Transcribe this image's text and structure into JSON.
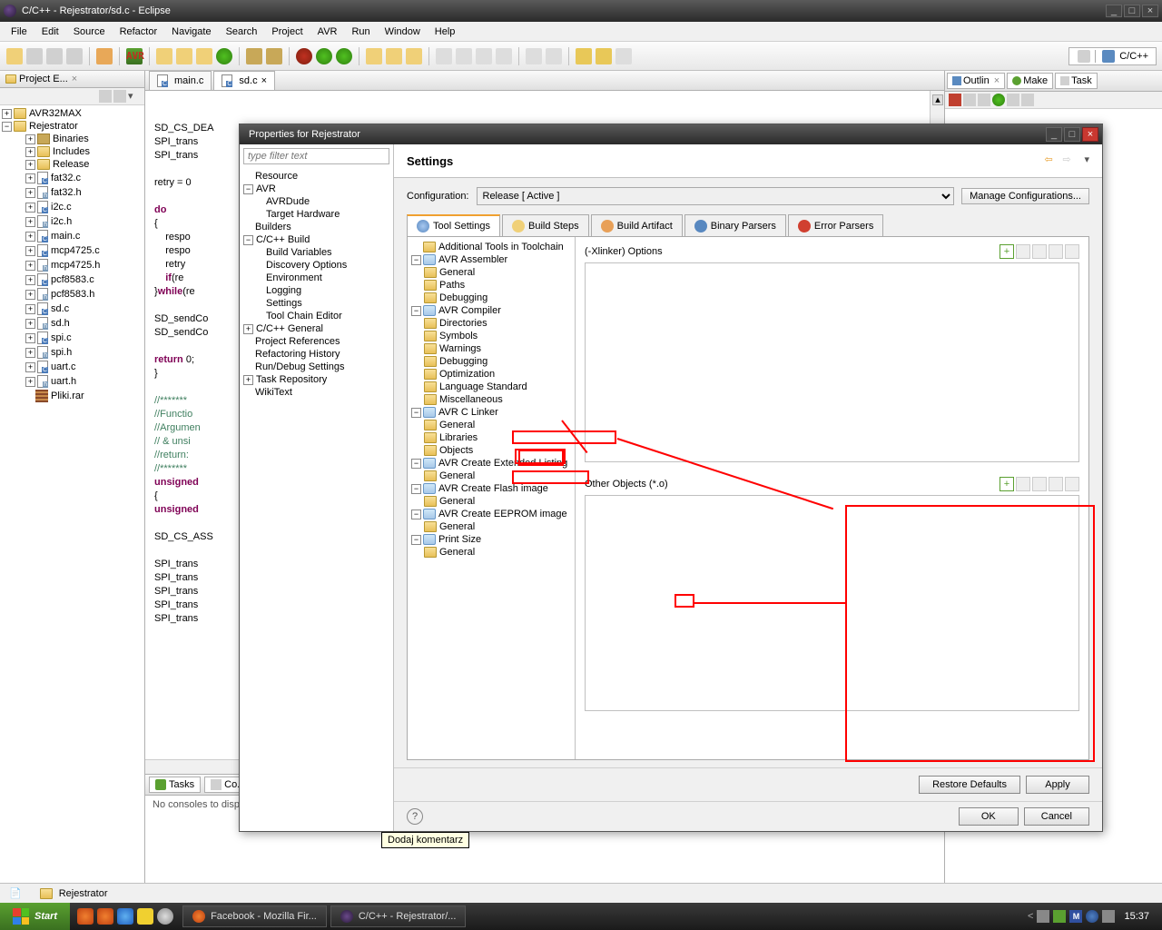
{
  "window": {
    "title": "C/C++ - Rejestrator/sd.c - Eclipse"
  },
  "menu": [
    "File",
    "Edit",
    "Source",
    "Refactor",
    "Navigate",
    "Search",
    "Project",
    "AVR",
    "Run",
    "Window",
    "Help"
  ],
  "perspective_label": "C/C++",
  "views": {
    "project_explorer_label": "Project E..."
  },
  "project_tree": {
    "root1": "AVR32MAX",
    "root2": "Rejestrator",
    "children": [
      {
        "label": "Binaries",
        "type": "bin"
      },
      {
        "label": "Includes",
        "type": "folder"
      },
      {
        "label": "Release",
        "type": "folder"
      },
      {
        "label": "fat32.c",
        "type": "c"
      },
      {
        "label": "fat32.h",
        "type": "h"
      },
      {
        "label": "i2c.c",
        "type": "c"
      },
      {
        "label": "i2c.h",
        "type": "h"
      },
      {
        "label": "main.c",
        "type": "c"
      },
      {
        "label": "mcp4725.c",
        "type": "c"
      },
      {
        "label": "mcp4725.h",
        "type": "h"
      },
      {
        "label": "pcf8583.c",
        "type": "c"
      },
      {
        "label": "pcf8583.h",
        "type": "h"
      },
      {
        "label": "sd.c",
        "type": "c"
      },
      {
        "label": "sd.h",
        "type": "h"
      },
      {
        "label": "spi.c",
        "type": "c"
      },
      {
        "label": "spi.h",
        "type": "h"
      },
      {
        "label": "uart.c",
        "type": "c"
      },
      {
        "label": "uart.h",
        "type": "h"
      },
      {
        "label": "Pliki.rar",
        "type": "rar"
      }
    ]
  },
  "editor_tabs": [
    {
      "label": "main.c"
    },
    {
      "label": "sd.c",
      "active": true
    }
  ],
  "code_lines": [
    "SD_CS_DEA",
    "SPI_trans",
    "SPI_trans",
    "",
    "retry = 0",
    "",
    "do",
    "{",
    "    respo",
    "    respo",
    "    retry",
    "    if(re",
    "}while(re",
    "",
    "SD_sendCo",
    "SD_sendCo",
    "",
    "return 0;",
    "}",
    "",
    "//*******",
    "//Functio",
    "//Argumen",
    "// & unsi",
    "//return:",
    "//*******",
    "unsigned",
    "{",
    "unsigned",
    "",
    "SD_CS_ASS",
    "",
    "SPI_trans",
    "SPI_trans",
    "SPI_trans",
    "SPI_trans",
    "SPI_trans"
  ],
  "bottom_view": {
    "tabs": [
      "Tasks",
      "Co..."
    ],
    "body": "No consoles to displ"
  },
  "right_tabs": [
    "Outlin",
    "Make",
    "Task"
  ],
  "dialog": {
    "title": "Properties for Rejestrator",
    "filter_placeholder": "type filter text",
    "left_tree": [
      {
        "label": "Resource",
        "lvl": 0,
        "exp": ""
      },
      {
        "label": "AVR",
        "lvl": 0,
        "exp": "−"
      },
      {
        "label": "AVRDude",
        "lvl": 1,
        "exp": ""
      },
      {
        "label": "Target Hardware",
        "lvl": 1,
        "exp": ""
      },
      {
        "label": "Builders",
        "lvl": 0,
        "exp": ""
      },
      {
        "label": "C/C++ Build",
        "lvl": 0,
        "exp": "−"
      },
      {
        "label": "Build Variables",
        "lvl": 1,
        "exp": ""
      },
      {
        "label": "Discovery Options",
        "lvl": 1,
        "exp": ""
      },
      {
        "label": "Environment",
        "lvl": 1,
        "exp": ""
      },
      {
        "label": "Logging",
        "lvl": 1,
        "exp": ""
      },
      {
        "label": "Settings",
        "lvl": 1,
        "exp": "",
        "hl": true
      },
      {
        "label": "Tool Chain Editor",
        "lvl": 1,
        "exp": ""
      },
      {
        "label": "C/C++ General",
        "lvl": 0,
        "exp": "+"
      },
      {
        "label": "Project References",
        "lvl": 0,
        "exp": ""
      },
      {
        "label": "Refactoring History",
        "lvl": 0,
        "exp": ""
      },
      {
        "label": "Run/Debug Settings",
        "lvl": 0,
        "exp": ""
      },
      {
        "label": "Task Repository",
        "lvl": 0,
        "exp": "+"
      },
      {
        "label": "WikiText",
        "lvl": 0,
        "exp": ""
      }
    ],
    "header": "Settings",
    "config_label": "Configuration:",
    "config_value": "Release  [ Active ]",
    "manage_btn": "Manage Configurations...",
    "tabs": [
      "Tool Settings",
      "Build Steps",
      "Build Artifact",
      "Binary Parsers",
      "Error Parsers"
    ],
    "settings_tree": [
      {
        "label": "Additional Tools in Toolchain",
        "lvl": 0,
        "type": "tool",
        "exp": ""
      },
      {
        "label": "AVR Assembler",
        "lvl": 0,
        "type": "group",
        "exp": "−"
      },
      {
        "label": "General",
        "lvl": 1,
        "type": "tool"
      },
      {
        "label": "Paths",
        "lvl": 1,
        "type": "tool"
      },
      {
        "label": "Debugging",
        "lvl": 1,
        "type": "tool"
      },
      {
        "label": "AVR Compiler",
        "lvl": 0,
        "type": "group",
        "exp": "−"
      },
      {
        "label": "Directories",
        "lvl": 1,
        "type": "tool"
      },
      {
        "label": "Symbols",
        "lvl": 1,
        "type": "tool"
      },
      {
        "label": "Warnings",
        "lvl": 1,
        "type": "tool"
      },
      {
        "label": "Debugging",
        "lvl": 1,
        "type": "tool"
      },
      {
        "label": "Optimization",
        "lvl": 1,
        "type": "tool"
      },
      {
        "label": "Language Standard",
        "lvl": 1,
        "type": "tool"
      },
      {
        "label": "Miscellaneous",
        "lvl": 1,
        "type": "tool"
      },
      {
        "label": "AVR C Linker",
        "lvl": 0,
        "type": "group",
        "exp": "−",
        "hl": true
      },
      {
        "label": "General",
        "lvl": 1,
        "type": "tool"
      },
      {
        "label": "Libraries",
        "lvl": 1,
        "type": "tool"
      },
      {
        "label": "Objects",
        "lvl": 1,
        "type": "tool",
        "hl": true
      },
      {
        "label": "AVR Create Extended Listing",
        "lvl": 0,
        "type": "group",
        "exp": "−"
      },
      {
        "label": "General",
        "lvl": 1,
        "type": "tool"
      },
      {
        "label": "AVR Create Flash image",
        "lvl": 0,
        "type": "group",
        "exp": "−"
      },
      {
        "label": "General",
        "lvl": 1,
        "type": "tool"
      },
      {
        "label": "AVR Create EEPROM image",
        "lvl": 0,
        "type": "group",
        "exp": "−"
      },
      {
        "label": "General",
        "lvl": 1,
        "type": "tool"
      },
      {
        "label": "Print Size",
        "lvl": 0,
        "type": "group",
        "exp": "−"
      },
      {
        "label": "General",
        "lvl": 1,
        "type": "tool"
      }
    ],
    "opts1_title": "(-Xlinker) Options",
    "opts2_title": "Other Objects (*.o)",
    "restore_btn": "Restore Defaults",
    "apply_btn": "Apply",
    "ok_btn": "OK",
    "cancel_btn": "Cancel"
  },
  "tooltip": "Dodaj komentarz",
  "statusbar_text": "Rejestrator",
  "taskbar": {
    "start": "Start",
    "tasks": [
      "Facebook - Mozilla Fir...",
      "C/C++ - Rejestrator/..."
    ],
    "clock": "15:37"
  }
}
